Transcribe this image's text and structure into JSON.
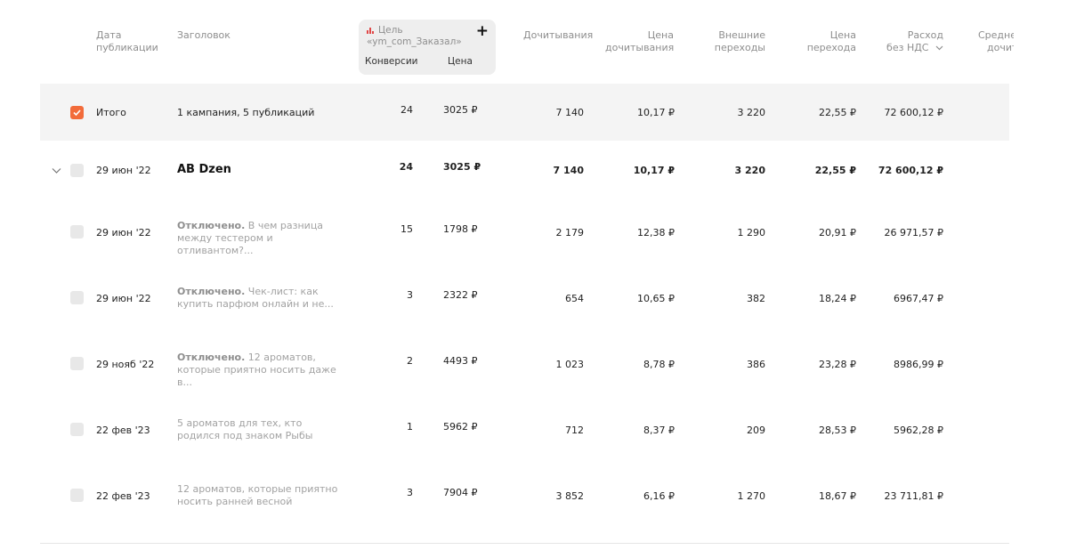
{
  "columns": {
    "date": [
      "Дата",
      "публикации"
    ],
    "title": "Заголовок",
    "goal_title": [
      "Цель",
      "«ym_com_Заказал»"
    ],
    "goal_conv": "Конверсии",
    "goal_price": "Цена",
    "reads": "Дочитывания",
    "read_price": [
      "Цена",
      "дочитывания"
    ],
    "ext": [
      "Внешние",
      "переходы"
    ],
    "trans_price": [
      "Цена",
      "перехода"
    ],
    "spend": [
      "Расход",
      "без НДС"
    ],
    "avg": [
      "Средне",
      "дочит"
    ]
  },
  "total": {
    "label": "Итого",
    "title": "1 кампания, 5 публикаций",
    "conv": "24",
    "price": "3025 ₽",
    "reads": "7 140",
    "read_price": "10,17 ₽",
    "ext": "3 220",
    "trans_price": "22,55 ₽",
    "spend": "72 600,12 ₽"
  },
  "campaign": {
    "date": "29 июн '22",
    "title": "AB Dzen",
    "conv": "24",
    "price": "3025 ₽",
    "reads": "7 140",
    "read_price": "10,17 ₽",
    "ext": "3 220",
    "trans_price": "22,55 ₽",
    "spend": "72 600,12 ₽"
  },
  "rows": [
    {
      "date": "29 июн '22",
      "status": "Отключено.",
      "title": "В чем разница между тестером и отливантом?...",
      "conv": "15",
      "price": "1798 ₽",
      "reads": "2 179",
      "read_price": "12,38 ₽",
      "ext": "1 290",
      "trans_price": "20,91 ₽",
      "spend": "26 971,57 ₽"
    },
    {
      "date": "29 июн '22",
      "status": "Отключено.",
      "title": "Чек-лист: как купить парфюм онлайн и не...",
      "conv": "3",
      "price": "2322 ₽",
      "reads": "654",
      "read_price": "10,65 ₽",
      "ext": "382",
      "trans_price": "18,24 ₽",
      "spend": "6967,47 ₽"
    },
    {
      "date": "29 нояб '22",
      "status": "Отключено.",
      "title": "12 ароматов, которые приятно носить даже в...",
      "conv": "2",
      "price": "4493 ₽",
      "reads": "1 023",
      "read_price": "8,78 ₽",
      "ext": "386",
      "trans_price": "23,28 ₽",
      "spend": "8986,99 ₽"
    },
    {
      "date": "22 фев '23",
      "status": "",
      "title": "5 ароматов для тех, кто родился под знаком Рыбы",
      "conv": "1",
      "price": "5962 ₽",
      "reads": "712",
      "read_price": "8,37 ₽",
      "ext": "209",
      "trans_price": "28,53 ₽",
      "spend": "5962,28 ₽"
    },
    {
      "date": "22 фев '23",
      "status": "",
      "title": "12 ароматов, которые приятно носить ранней весной",
      "conv": "3",
      "price": "7904 ₽",
      "reads": "3 852",
      "read_price": "6,16 ₽",
      "ext": "1 270",
      "trans_price": "18,67 ₽",
      "spend": "23 711,81 ₽"
    }
  ],
  "colors": {
    "accent": "#f26b3a",
    "total_bg": "#f4f4f4",
    "goal_bg": "#eeeeee"
  },
  "icons": [
    "goal-chart-icon",
    "plus-icon",
    "sort-chevron-icon",
    "expand-chevron-icon",
    "checkmark-icon"
  ]
}
